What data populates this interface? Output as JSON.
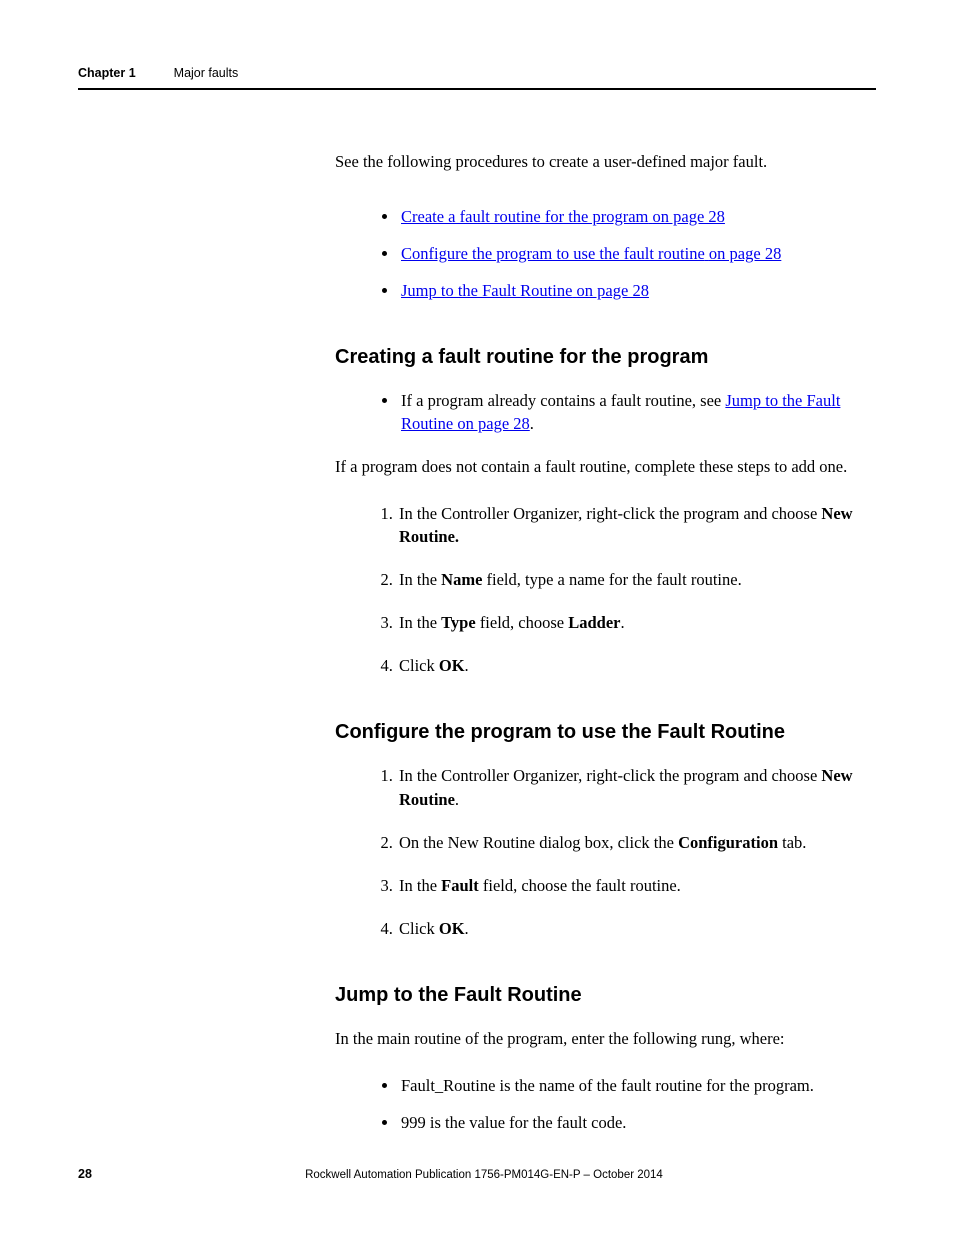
{
  "header": {
    "chapter_label": "Chapter 1",
    "chapter_title": "Major faults"
  },
  "intro": "See the following procedures to create a user-defined major fault.",
  "top_links": [
    {
      "text": "Create a fault routine for the program",
      "page": "on page 28"
    },
    {
      "text": "Configure the program to use the fault routine",
      "page": "on page 28"
    },
    {
      "text": "Jump to the Fault Routine",
      "page": "on page 28"
    }
  ],
  "section1": {
    "heading": "Creating a fault routine for the program",
    "bullet_pre": "If a program already contains a fault routine, see ",
    "bullet_link": "Jump to the Fault Routine on page 28",
    "bullet_post": ".",
    "para": "If a program does not contain a fault routine, complete these steps to add one.",
    "steps": [
      {
        "pre": "In the Controller Organizer, right-click the program and choose ",
        "bold": "New Routine.",
        "post": ""
      },
      {
        "pre": "In the ",
        "bold": "Name",
        "post": " field, type a name for the fault routine."
      },
      {
        "pre": "In the ",
        "bold": "Type",
        "mid": " field, choose ",
        "bold2": "Ladder",
        "post": "."
      },
      {
        "pre": "Click ",
        "bold": "OK",
        "post": "."
      }
    ]
  },
  "section2": {
    "heading": "Configure the program to use the Fault Routine",
    "steps": [
      {
        "pre": "In the Controller Organizer, right-click the program and choose ",
        "bold": "New Routine",
        "post": "."
      },
      {
        "pre": "On the New Routine dialog box, click the ",
        "bold": "Configuration",
        "post": " tab."
      },
      {
        "pre": "In the ",
        "bold": "Fault",
        "post": " field, choose the fault routine."
      },
      {
        "pre": "Click ",
        "bold": "OK",
        "post": "."
      }
    ]
  },
  "section3": {
    "heading": "Jump to the Fault Routine",
    "para": "In the main routine of the program, enter the following rung, where:",
    "bullets": [
      "Fault_Routine is the name of the fault routine for the program.",
      "999 is the value for the fault code."
    ]
  },
  "footer": {
    "page_num": "28",
    "pub_info": "Rockwell Automation Publication 1756-PM014G-EN-P – October 2014"
  }
}
